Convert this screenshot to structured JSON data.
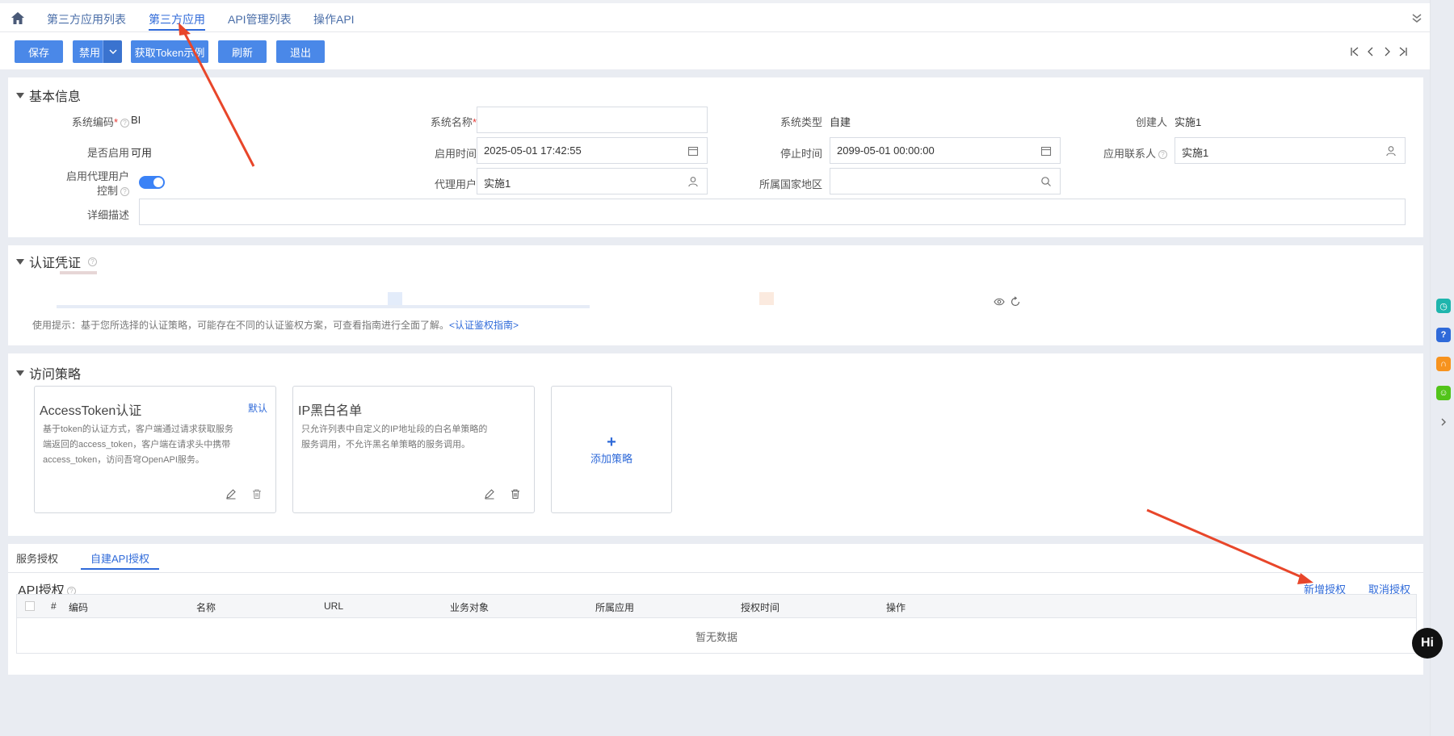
{
  "top_tabs": [
    {
      "label": "第三方应用列表",
      "active": false
    },
    {
      "label": "第三方应用",
      "active": true
    },
    {
      "label": "API管理列表",
      "active": false
    },
    {
      "label": "操作API",
      "active": false
    }
  ],
  "toolbar": {
    "save_label": "保存",
    "disable_label": "禁用",
    "token_example_label": "获取Token示例",
    "refresh_label": "刷新",
    "exit_label": "退出"
  },
  "basic_info": {
    "title": "基本信息",
    "system_code_label": "系统编码",
    "system_code_value": "BI",
    "system_name_label": "系统名称",
    "system_name_value": "",
    "system_type_label": "系统类型",
    "system_type_value": "自建",
    "creator_label": "创建人",
    "creator_value": "实施1",
    "enabled_label": "是否启用",
    "enabled_value": "可用",
    "start_time_label": "启用时间",
    "start_time_value": "2025-05-01 17:42:55",
    "stop_time_label": "停止时间",
    "stop_time_value": "2099-05-01 00:00:00",
    "contact_label": "应用联系人",
    "contact_value": "实施1",
    "proxy_control_label_1": "启用代理用户",
    "proxy_control_label_2": "控制",
    "proxy_user_label": "代理用户",
    "proxy_user_value": "实施1",
    "region_label": "所属国家地区",
    "region_value": "",
    "description_label": "详细描述",
    "description_value": ""
  },
  "credentials": {
    "title": "认证凭证",
    "hint": "使用提示：基于您所选择的认证策略，可能存在不同的认证鉴权方案，可查看指南进行全面了解。",
    "guide_link": "<认证鉴权指南>"
  },
  "access_policy": {
    "title": "访问策略",
    "cards": [
      {
        "title": "AccessToken认证",
        "tag": "默认",
        "desc": "基于token的认证方式，客户端通过请求获取服务端返回的access_token，客户端在请求头中携带access_token，访问吾穹OpenAPI服务。"
      },
      {
        "title": "IP黑白名单",
        "tag": "",
        "desc": "只允许列表中自定义的IP地址段的白名单策略的服务调用，不允许黑名单策略的服务调用。"
      }
    ],
    "add_label": "添加策略",
    "add_plus": "+"
  },
  "auth_section": {
    "tabs": [
      {
        "label": "服务授权",
        "active": false
      },
      {
        "label": "自建API授权",
        "active": true
      }
    ],
    "api_auth_title": "API授权",
    "add_auth_label": "新增授权",
    "cancel_auth_label": "取消授权",
    "columns": [
      "#",
      "编码",
      "名称",
      "URL",
      "业务对象",
      "所属应用",
      "授权时间",
      "操作"
    ],
    "empty_text": "暂无数据"
  },
  "side_widgets": {
    "hi_badge": "Hi"
  },
  "colors": {
    "accent": "#2f6ad9",
    "button": "#4a88e8",
    "annotation_arrow": "#e8462a"
  }
}
